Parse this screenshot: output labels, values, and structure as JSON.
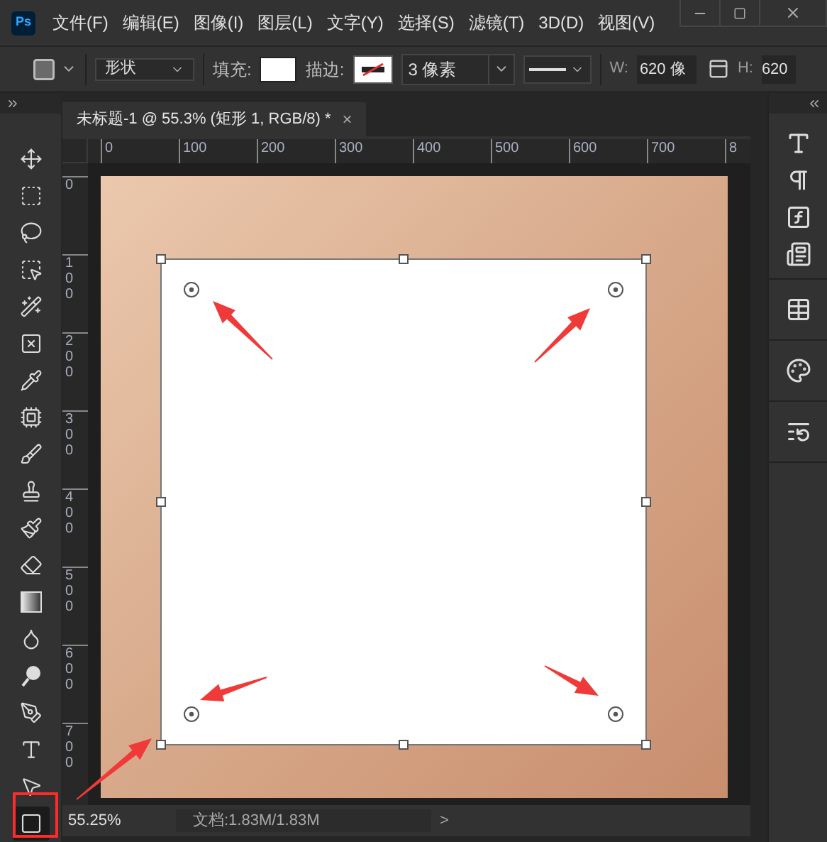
{
  "menu_bar": {
    "logo": "Ps",
    "items": [
      "文件(F)",
      "编辑(E)",
      "图像(I)",
      "图层(L)",
      "文字(Y)",
      "选择(S)",
      "滤镜(T)",
      "3D(D)",
      "视图(V)"
    ]
  },
  "options_bar": {
    "mode": "形状",
    "fill_label": "填充:",
    "stroke_label": "描边:",
    "stroke_width": "3 像素",
    "w_label": "W:",
    "w_value": "620 像",
    "h_label": "H:",
    "h_value": "620"
  },
  "tools": [
    {
      "kind": "move",
      "selected": false
    },
    {
      "kind": "marquee",
      "selected": false
    },
    {
      "kind": "lasso",
      "selected": false
    },
    {
      "kind": "object-select",
      "selected": false
    },
    {
      "kind": "wand",
      "selected": false
    },
    {
      "kind": "frame",
      "selected": false
    },
    {
      "kind": "eyedropper",
      "selected": false
    },
    {
      "kind": "patch",
      "selected": false
    },
    {
      "kind": "brush",
      "selected": false
    },
    {
      "kind": "stamp",
      "selected": false
    },
    {
      "kind": "history-brush",
      "selected": false
    },
    {
      "kind": "eraser",
      "selected": false
    },
    {
      "kind": "gradient",
      "selected": false
    },
    {
      "kind": "blur",
      "selected": false
    },
    {
      "kind": "dodge",
      "selected": false
    },
    {
      "kind": "pen",
      "selected": false
    },
    {
      "kind": "type",
      "selected": false
    },
    {
      "kind": "path-select",
      "selected": false
    },
    {
      "kind": "rectangle",
      "selected": true
    }
  ],
  "document_tab": {
    "title": "未标题-1 @ 55.3% (矩形 1, RGB/8) *",
    "close": "×",
    "selected": true
  },
  "ruler": {
    "horizontal": [
      "0",
      "100",
      "200",
      "300",
      "400",
      "500",
      "600",
      "700",
      "8"
    ],
    "vertical": [
      "0",
      "100",
      "200",
      "300",
      "400",
      "500",
      "600",
      "700"
    ]
  },
  "status_bar": {
    "zoom": "55.25%",
    "doc_size": "文档:1.83M/1.83M",
    "more": ">"
  }
}
